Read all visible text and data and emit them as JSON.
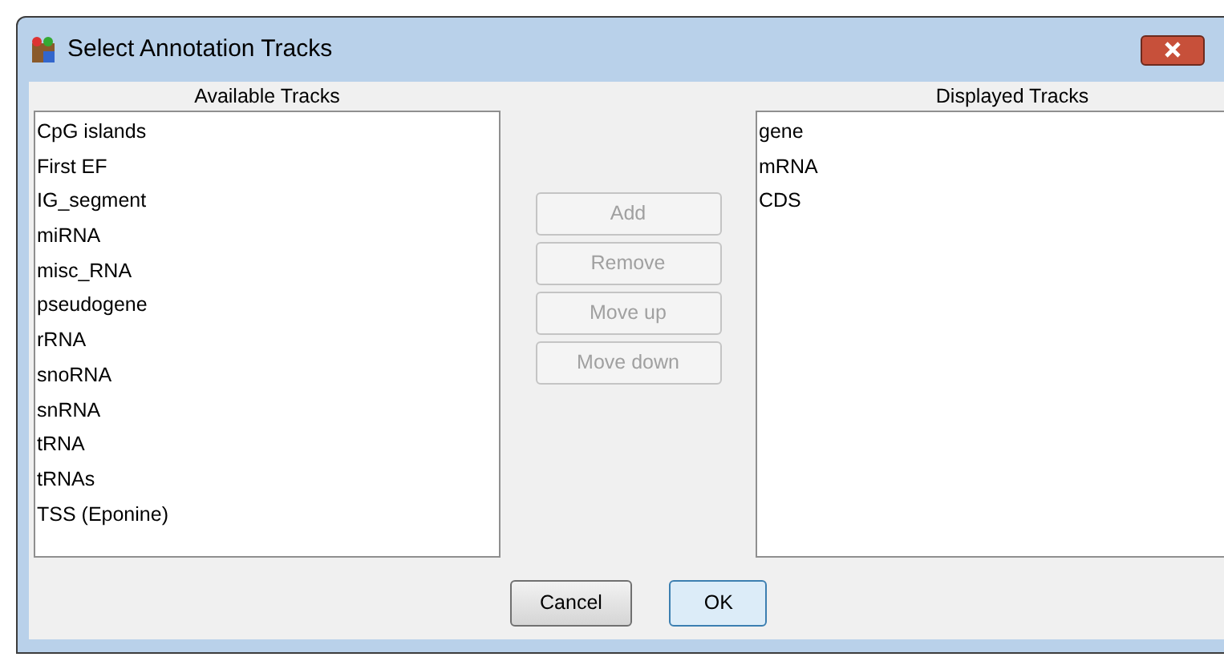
{
  "window": {
    "title": "Select Annotation Tracks"
  },
  "available": {
    "label": "Available Tracks",
    "items": [
      "CpG islands",
      "First EF",
      "IG_segment",
      "miRNA",
      "misc_RNA",
      "pseudogene",
      "rRNA",
      "snoRNA",
      "snRNA",
      "tRNA",
      "tRNAs",
      "TSS (Eponine)"
    ]
  },
  "actions": [
    {
      "label": "Add",
      "disabled": true
    },
    {
      "label": "Remove",
      "disabled": true
    },
    {
      "label": "Move up",
      "disabled": true
    },
    {
      "label": "Move down",
      "disabled": true
    }
  ],
  "displayed": {
    "label": "Displayed Tracks",
    "items": [
      "gene",
      "mRNA",
      "CDS"
    ]
  },
  "buttons": [
    {
      "label": "Cancel",
      "default": false
    },
    {
      "label": "OK",
      "default": true
    }
  ]
}
